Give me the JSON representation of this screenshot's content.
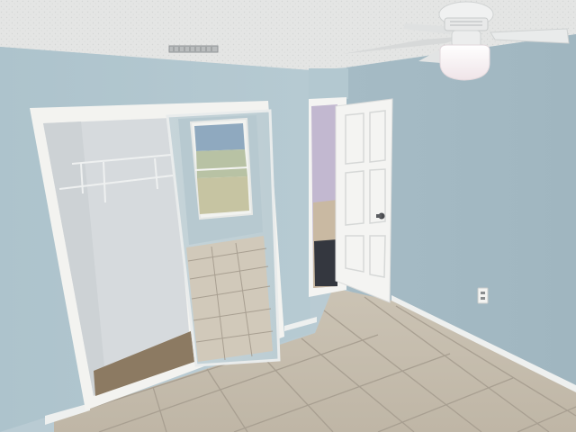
{
  "scene": {
    "kind": "photo",
    "room": "empty bedroom",
    "elements": [
      "textured-ceiling",
      "ceiling-fan-with-light",
      "air-vent",
      "closet-with-sliding-mirror-door",
      "closet-wire-shelf",
      "window-reflection-in-mirror",
      "open-interior-door",
      "hallway",
      "tile-floor",
      "baseboard",
      "wall-outlet"
    ]
  },
  "colors": {
    "wall": "#b2c7cf",
    "wall_right": "#a9bec7",
    "ceiling": "#e6e7e6",
    "floor_tile": "#cfc6b6",
    "grout": "#a89f91",
    "trim": "#f2f2ef",
    "door": "#f4f4f2",
    "closet_interior": "#d9dde0",
    "closet_carpet": "#8c7a62",
    "hallway_wall": "#c2b8d0",
    "fan_blade": "#e8eaea",
    "light_globe": "#fbf7f5"
  }
}
